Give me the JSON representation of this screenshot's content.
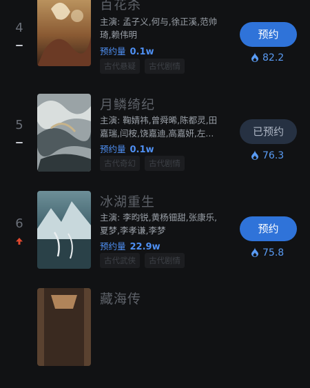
{
  "items": [
    {
      "rank": "4",
      "trend": "flat",
      "poster_icon": "poster-baihuasha",
      "title": "百花杀",
      "cast": "主演: 孟子义,何与,徐正溪,范帅琦,赖伟明",
      "appt_label": "预约量",
      "appt_value": "0.1w",
      "tags": [
        "古代悬疑",
        "古代剧情"
      ],
      "button": "预约",
      "button_state": "active",
      "heat": "82.2"
    },
    {
      "rank": "5",
      "trend": "flat",
      "poster_icon": "poster-yuelin",
      "title": "月鳞绮纪",
      "cast": "主演: 鞠婧祎,曾舜晞,陈都灵,田嘉瑞,闫桉,饶嘉迪,高嘉妍,左...",
      "appt_label": "预约量",
      "appt_value": "0.1w",
      "tags": [
        "古代奇幻",
        "古代剧情"
      ],
      "button": "已预约",
      "button_state": "done",
      "heat": "76.3"
    },
    {
      "rank": "6",
      "trend": "up",
      "poster_icon": "poster-binghu",
      "title": "冰湖重生",
      "cast": "主演: 李昀锐,黄杨钿甜,张康乐,夏梦,李孝谦,李梦",
      "appt_label": "预约量",
      "appt_value": "22.9w",
      "tags": [
        "古代武侠",
        "古代剧情"
      ],
      "button": "预约",
      "button_state": "active",
      "heat": "75.8"
    },
    {
      "poster_icon": "poster-canghai",
      "title": "藏海传"
    }
  ],
  "colors": {
    "accent": "#2f73d9",
    "appt": "#4e8ff2",
    "up_arrow": "#e0492f"
  }
}
